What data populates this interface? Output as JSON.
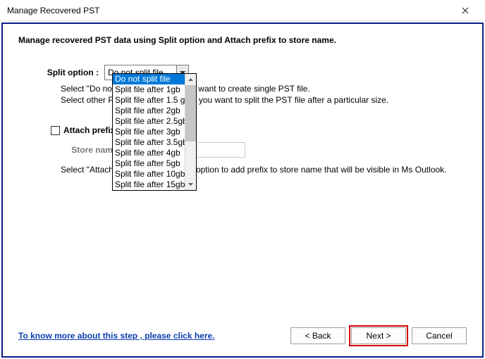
{
  "titlebar": {
    "title": "Manage Recovered PST"
  },
  "heading": "Manage recovered PST data using Split option and Attach prefix to store name.",
  "split": {
    "label": "Split option :",
    "selected": "Do not split file",
    "options": [
      "Do not split file",
      "Split file after 1gb",
      "Split file after 1.5 gb",
      "Split file after 2gb",
      "Split file after 2.5gb",
      "Split file after 3gb",
      "Split file after 3.5gb",
      "Split file after 4gb",
      "Split file after 5gb",
      "Split file after 10gb",
      "Split file after 15gb"
    ],
    "hint1": "Select \"Do not split file\" option if you want to create single PST file.",
    "hint2": "Select other PST split option if you if you want to split the PST file after a particular size."
  },
  "attach": {
    "checkbox_label": "Attach prefix to store name",
    "store_label": "Store name prefix :",
    "hint": "Select \"Attach prefix to store name\" option to add prefix to store name that will be visible in Ms Outlook."
  },
  "footer": {
    "help": "To know more about this step , please click here.",
    "back": "< Back",
    "next": "Next >",
    "cancel": "Cancel"
  }
}
